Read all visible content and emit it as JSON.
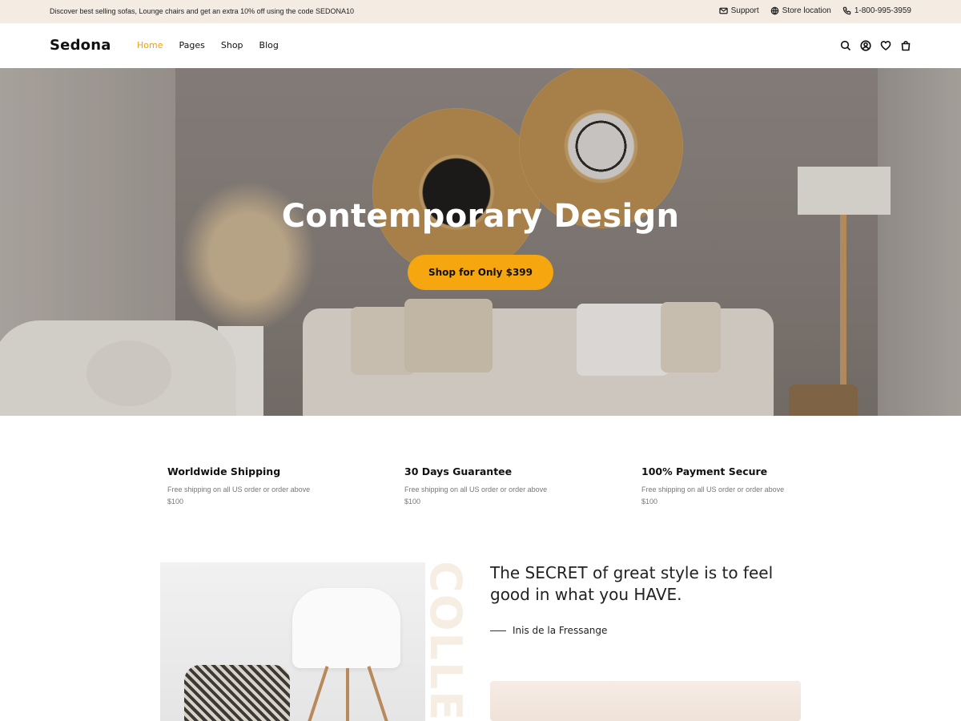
{
  "topbar": {
    "promo": "Discover best selling sofas, Lounge chairs and get an extra 10% off using the code SEDONA10",
    "links": [
      {
        "label": "Support",
        "icon": "mail-icon"
      },
      {
        "label": "Store location",
        "icon": "globe-icon"
      },
      {
        "label": "1-800-995-3959",
        "icon": "phone-icon"
      }
    ]
  },
  "header": {
    "logo": "Sedona",
    "nav": [
      "Home",
      "Pages",
      "Shop",
      "Blog"
    ],
    "active_nav": "Home",
    "icons": [
      "search-icon",
      "user-icon",
      "heart-icon",
      "bag-icon"
    ],
    "accent_color": "#f1a10f"
  },
  "hero": {
    "title": "Contemporary Design",
    "button": "Shop for Only $399",
    "button_color": "#f6a70f"
  },
  "features": [
    {
      "title": "Worldwide Shipping",
      "text": "Free shipping on all US order or order above $100"
    },
    {
      "title": "30 Days Guarantee",
      "text": "Free shipping on all US order or order above $100"
    },
    {
      "title": "100% Payment Secure",
      "text": "Free shipping on all US order or order above $100"
    }
  ],
  "quote": {
    "text": "The SECRET of great style is to feel good in what you HAVE.",
    "author": "Inis de la Fressange",
    "vertical_word": "COLLE"
  }
}
